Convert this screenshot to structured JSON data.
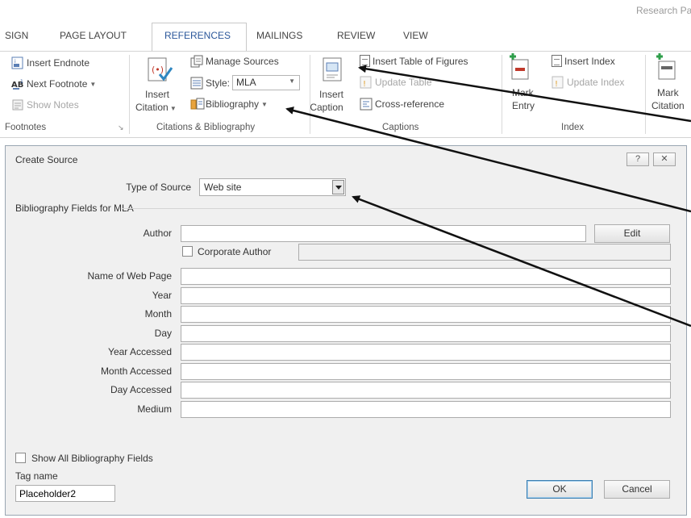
{
  "doc_title": "Research Pap",
  "tabs": [
    "SIGN",
    "PAGE LAYOUT",
    "REFERENCES",
    "MAILINGS",
    "REVIEW",
    "VIEW"
  ],
  "active_tab": "REFERENCES",
  "ribbon": {
    "footnotes": {
      "insert_endnote": "Insert Endnote",
      "next_footnote": "Next Footnote",
      "show_notes": "Show Notes",
      "group_label": "Footnotes"
    },
    "citations": {
      "insert_citation_line1": "Insert",
      "insert_citation_line2": "Citation",
      "manage_sources": "Manage Sources",
      "style_label": "Style:",
      "style_value": "MLA",
      "bibliography": "Bibliography",
      "group_label": "Citations & Bibliography"
    },
    "captions": {
      "insert_caption_line1": "Insert",
      "insert_caption_line2": "Caption",
      "insert_table_of_figures": "Insert Table of Figures",
      "update_table": "Update Table",
      "cross_reference": "Cross-reference",
      "group_label": "Captions"
    },
    "index": {
      "mark_entry_line1": "Mark",
      "mark_entry_line2": "Entry",
      "insert_index": "Insert Index",
      "update_index": "Update Index",
      "group_label": "Index"
    },
    "citation_table": {
      "mark_citation_line1": "Mark",
      "mark_citation_line2": "Citation"
    }
  },
  "dialog": {
    "title": "Create Source",
    "help_glyph": "?",
    "close_glyph": "✕",
    "type_of_source_label": "Type of Source",
    "type_of_source_value": "Web site",
    "section_label": "Bibliography Fields for MLA",
    "author_label": "Author",
    "edit_button": "Edit",
    "corporate_author_label": "Corporate Author",
    "fields": [
      {
        "label": "Name of Web Page",
        "value": ""
      },
      {
        "label": "Year",
        "value": ""
      },
      {
        "label": "Month",
        "value": ""
      },
      {
        "label": "Day",
        "value": ""
      },
      {
        "label": "Year Accessed",
        "value": ""
      },
      {
        "label": "Month Accessed",
        "value": ""
      },
      {
        "label": "Day Accessed",
        "value": ""
      },
      {
        "label": "Medium",
        "value": ""
      }
    ],
    "show_all_fields_label": "Show All Bibliography Fields",
    "tag_name_label": "Tag name",
    "tag_name_value": "Placeholder2",
    "ok_button": "OK",
    "cancel_button": "Cancel"
  },
  "colors": {
    "accent": "#2b579a",
    "arrow": "#111111",
    "dialog_bg": "#f0f0f0"
  }
}
